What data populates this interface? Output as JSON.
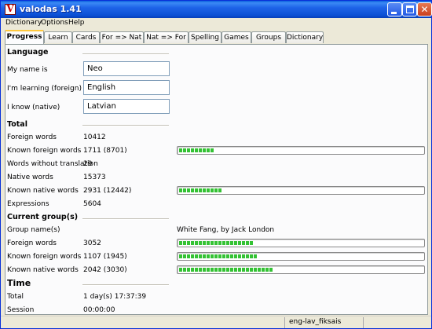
{
  "window": {
    "title": "valodas 1.41",
    "app_icon_letter": "V"
  },
  "menu": [
    "Dictionary",
    "Options",
    "Help"
  ],
  "tabs": [
    "Progress",
    "Learn",
    "Cards",
    "For => Nat",
    "Nat => For",
    "Spelling",
    "Games",
    "Groups",
    "Dictionary"
  ],
  "active_tab": "Progress",
  "language": {
    "heading": "Language",
    "name_label": "My name is",
    "name_value": "Neo",
    "learning_label": "I'm learning (foreign)",
    "learning_value": "English",
    "know_label": "I know (native)",
    "know_value": "Latvian"
  },
  "total": {
    "heading": "Total",
    "rows": [
      {
        "label": "Foreign words",
        "value": "10412"
      },
      {
        "label": "Known foreign words",
        "value": "1711 (8701)",
        "progress_segments": 9
      },
      {
        "label": "Words without translation",
        "value": "29"
      },
      {
        "label": "Native words",
        "value": "15373"
      },
      {
        "label": "Known native words",
        "value": "2931 (12442)",
        "progress_segments": 11
      },
      {
        "label": "Expressions",
        "value": "5604"
      }
    ]
  },
  "current_groups": {
    "heading": "Current group(s)",
    "group_label": "Group name(s)",
    "group_value": "White Fang, by Jack London",
    "rows": [
      {
        "label": "Foreign words",
        "value": "3052",
        "progress_segments": 19
      },
      {
        "label": "Known foreign words",
        "value": "1107 (1945)",
        "progress_segments": 20
      },
      {
        "label": "Known native words",
        "value": "2042 (3030)",
        "progress_segments": 24
      }
    ]
  },
  "time": {
    "heading": "Time",
    "total_label": "Total",
    "total_value": "1 day(s) 17:37:39",
    "session_label": "Session",
    "session_value": "00:00:00"
  },
  "status": {
    "dictionary": "eng-lav_fiksais"
  },
  "colors": {
    "progress": "#34c234",
    "titlebar": "#0b4fd4",
    "active_tab_accent": "#ffc83c"
  }
}
